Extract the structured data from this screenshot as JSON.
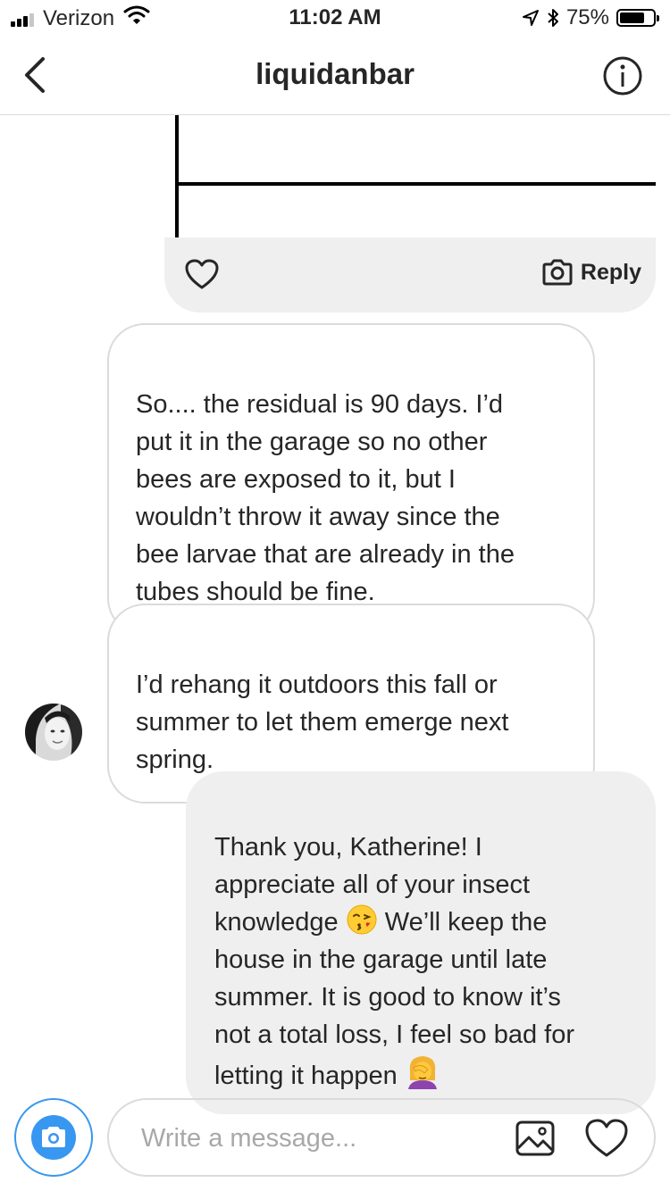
{
  "status_bar": {
    "carrier": "Verizon",
    "time": "11:02 AM",
    "battery": "75%",
    "battery_level": 0.75
  },
  "header": {
    "title": "liquidanbar",
    "back_icon": "chevron-left-icon",
    "info_icon": "info-icon"
  },
  "shared_post": {
    "reply_label": "Reply",
    "like_icon": "heart-outline-icon",
    "camera_icon": "camera-icon"
  },
  "messages": [
    {
      "sender": "them",
      "text": "So.... the residual is 90 days. I’d\nput it in the garage so no other\nbees are exposed to it, but I\nwouldn’t throw it away since the\nbee larvae that are already in the\ntubes should be fine."
    },
    {
      "sender": "them",
      "text": "I’d rehang it outdoors this fall or\nsummer to let them emerge next\nspring."
    },
    {
      "sender": "me",
      "line1": "Thank you, Katherine! I\nappreciate all of your insect\nknowledge ",
      "line2": " We’ll keep the\nhouse in the garage until late\nsummer. It is good to know it’s\nnot a total loss, I feel so bad for\nletting it happen ",
      "emoji1": "face-blowing-a-kiss-emoji",
      "emoji2": "woman-facepalming-emoji"
    }
  ],
  "composer": {
    "placeholder": "Write a message...",
    "camera_icon": "camera-icon",
    "gallery_icon": "image-icon",
    "heart_icon": "heart-outline-icon"
  },
  "colors": {
    "accent": "#3897f0",
    "bubble_out": "#efefef",
    "border": "#dbdbdb"
  }
}
